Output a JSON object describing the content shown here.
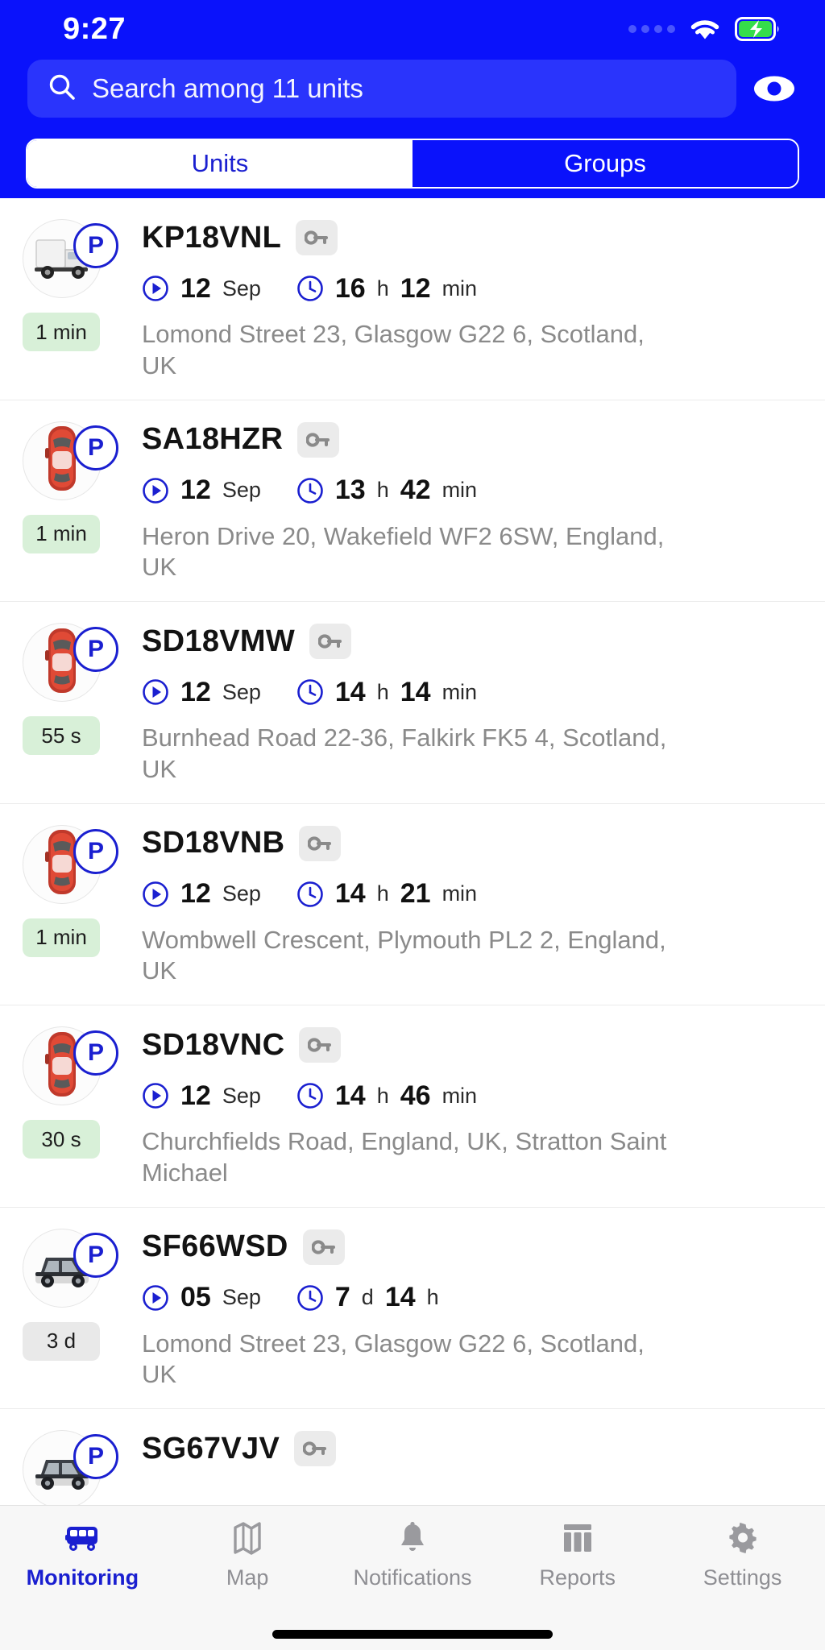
{
  "status_bar": {
    "time": "9:27",
    "signal_icon": "signal-dots-icon",
    "wifi_icon": "wifi-icon",
    "battery_icon": "battery-charging-icon"
  },
  "header": {
    "background_color": "#0a12fb",
    "search": {
      "icon": "search-icon",
      "placeholder": "Search among 11 units",
      "value": ""
    },
    "visibility_toggle": {
      "icon": "eye-icon",
      "label": "Toggle visibility"
    },
    "segments": [
      {
        "label": "Units",
        "active": true
      },
      {
        "label": "Groups",
        "active": false
      }
    ]
  },
  "units": [
    {
      "plate": "KP18VNL",
      "vehicle_icon": "truck-icon",
      "status_badge": "P",
      "lock_icon": "key-icon",
      "date": "12",
      "month": "Sep",
      "duration_value_1": "16",
      "duration_unit_1": "h",
      "duration_value_2": "12",
      "duration_unit_2": "min",
      "time_badge": "1 min",
      "time_badge_color": "green",
      "address": "Lomond Street 23, Glasgow G22 6, Scotland, UK"
    },
    {
      "plate": "SA18HZR",
      "vehicle_icon": "car-red-icon",
      "status_badge": "P",
      "lock_icon": "key-icon",
      "date": "12",
      "month": "Sep",
      "duration_value_1": "13",
      "duration_unit_1": "h",
      "duration_value_2": "42",
      "duration_unit_2": "min",
      "time_badge": "1 min",
      "time_badge_color": "green",
      "address": "Heron Drive 20, Wakefield WF2 6SW, England, UK"
    },
    {
      "plate": "SD18VMW",
      "vehicle_icon": "car-red-icon",
      "status_badge": "P",
      "lock_icon": "key-icon",
      "date": "12",
      "month": "Sep",
      "duration_value_1": "14",
      "duration_unit_1": "h",
      "duration_value_2": "14",
      "duration_unit_2": "min",
      "time_badge": "55 s",
      "time_badge_color": "green",
      "address": "Burnhead Road 22-36, Falkirk FK5 4, Scotland, UK"
    },
    {
      "plate": "SD18VNB",
      "vehicle_icon": "car-red-icon",
      "status_badge": "P",
      "lock_icon": "key-icon",
      "date": "12",
      "month": "Sep",
      "duration_value_1": "14",
      "duration_unit_1": "h",
      "duration_value_2": "21",
      "duration_unit_2": "min",
      "time_badge": "1 min",
      "time_badge_color": "green",
      "address": "Wombwell Crescent, Plymouth PL2 2, England, UK"
    },
    {
      "plate": "SD18VNC",
      "vehicle_icon": "car-red-icon",
      "status_badge": "P",
      "lock_icon": "key-icon",
      "date": "12",
      "month": "Sep",
      "duration_value_1": "14",
      "duration_unit_1": "h",
      "duration_value_2": "46",
      "duration_unit_2": "min",
      "time_badge": "30 s",
      "time_badge_color": "green",
      "address": "Churchfields Road, England, UK, Stratton Saint Michael"
    },
    {
      "plate": "SF66WSD",
      "vehicle_icon": "car-dark-icon",
      "status_badge": "P",
      "lock_icon": "key-icon",
      "date": "05",
      "month": "Sep",
      "duration_value_1": "7",
      "duration_unit_1": "d",
      "duration_value_2": "14",
      "duration_unit_2": "h",
      "time_badge": "3 d",
      "time_badge_color": "gray",
      "address": "Lomond Street 23, Glasgow G22 6, Scotland, UK"
    },
    {
      "plate": "SG67VJV",
      "vehicle_icon": "car-dark-icon",
      "status_badge": "P",
      "lock_icon": "key-icon",
      "date": "",
      "month": "",
      "duration_value_1": "",
      "duration_unit_1": "",
      "duration_value_2": "",
      "duration_unit_2": "",
      "time_badge": "",
      "time_badge_color": "green",
      "address": ""
    }
  ],
  "tabbar": {
    "items": [
      {
        "label": "Monitoring",
        "icon": "bus-icon",
        "active": true
      },
      {
        "label": "Map",
        "icon": "map-icon",
        "active": false
      },
      {
        "label": "Notifications",
        "icon": "bell-icon",
        "active": false
      },
      {
        "label": "Reports",
        "icon": "table-columns-icon",
        "active": false
      },
      {
        "label": "Settings",
        "icon": "gear-icon",
        "active": false
      }
    ]
  },
  "colors": {
    "brand_blue": "#0a12fb",
    "accent_blue": "#1a1fd0",
    "badge_green": "#d8f0d8",
    "badge_gray": "#e9e9e9",
    "address_gray": "#8a8a8a"
  }
}
